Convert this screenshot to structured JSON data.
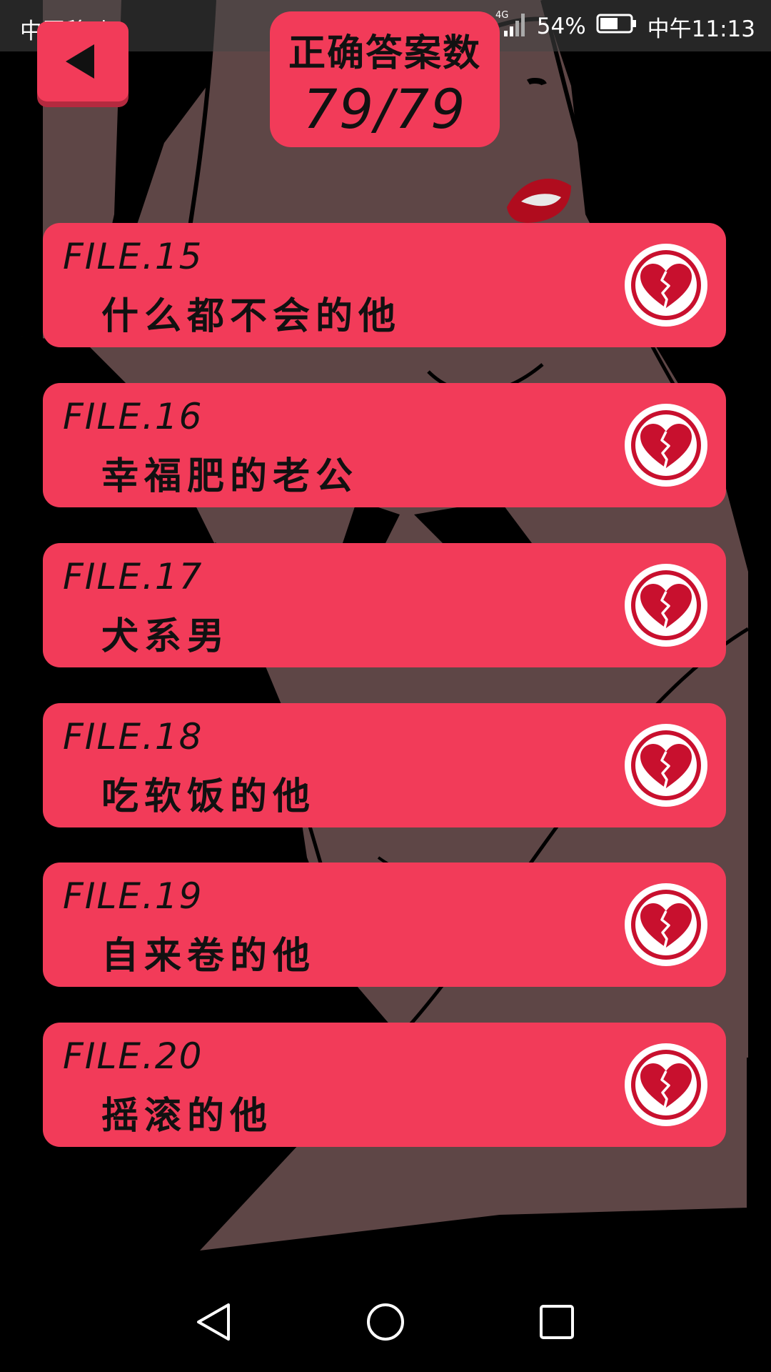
{
  "status_bar": {
    "carrier": "中国移动",
    "network": "4G",
    "battery_percent": "54%",
    "time": "中午11:13"
  },
  "score": {
    "label": "正确答案数",
    "value": "79/79"
  },
  "files": [
    {
      "number": "FILE.15",
      "title": "什么都不会的他",
      "icon": "broken-heart-icon"
    },
    {
      "number": "FILE.16",
      "title": "幸福肥的老公",
      "icon": "broken-heart-icon"
    },
    {
      "number": "FILE.17",
      "title": "犬系男",
      "icon": "broken-heart-icon"
    },
    {
      "number": "FILE.18",
      "title": "吃软饭的他",
      "icon": "broken-heart-icon"
    },
    {
      "number": "FILE.19",
      "title": "自来卷的他",
      "icon": "broken-heart-icon"
    },
    {
      "number": "FILE.20",
      "title": "摇滚的他",
      "icon": "broken-heart-icon"
    }
  ],
  "colors": {
    "accent": "#f23b59",
    "background_skin": "#5e4646",
    "heart": "#c8102e"
  }
}
